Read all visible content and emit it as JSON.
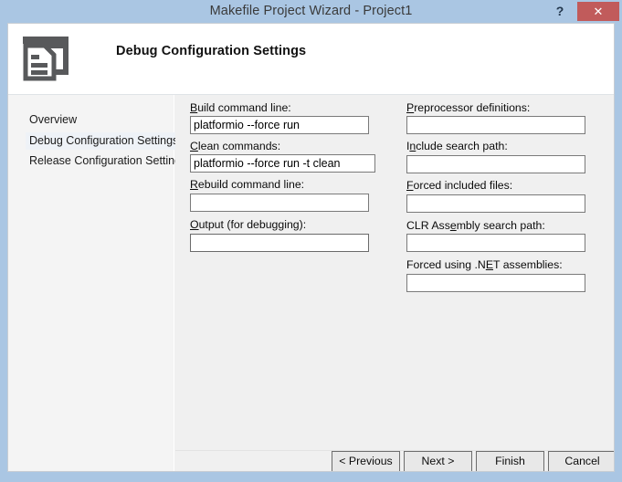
{
  "window": {
    "title": "Makefile Project Wizard - Project1",
    "help_label": "?",
    "close_label": "✕",
    "titlebar_color": "#aac6e3",
    "close_color": "#c15b5b"
  },
  "header": {
    "title": "Debug Configuration Settings",
    "icon": "window-document-icon"
  },
  "sidebar": {
    "items": [
      {
        "label": "Overview",
        "selected": false
      },
      {
        "label": "Debug Configuration Settings",
        "selected": true
      },
      {
        "label": "Release Configuration Settings",
        "selected": false
      }
    ]
  },
  "form": {
    "left_fields": [
      {
        "label": "Build command line:",
        "mnemonic": "B",
        "value": "platformio --force run",
        "placeholder": "",
        "focused": false
      },
      {
        "label": "Clean commands:",
        "mnemonic": "C",
        "value": "platformio --force run -t clean",
        "placeholder": "",
        "focused": false
      },
      {
        "label": "Rebuild command line:",
        "mnemonic": "R",
        "value": "",
        "placeholder": "",
        "focused": false
      },
      {
        "label": "Output (for debugging):",
        "mnemonic": "O",
        "value": "",
        "placeholder": "",
        "focused": true
      }
    ],
    "right_fields": [
      {
        "label": "Preprocessor definitions:",
        "mnemonic": "P",
        "value": "",
        "placeholder": "",
        "focused": false
      },
      {
        "label": "Include search path:",
        "mnemonic": "n",
        "value": "",
        "placeholder": "",
        "focused": false
      },
      {
        "label": "Forced included files:",
        "mnemonic": "F",
        "value": "",
        "placeholder": "",
        "focused": false
      },
      {
        "label": "CLR Assembly search path:",
        "mnemonic": "e",
        "value": "",
        "placeholder": "",
        "focused": false
      },
      {
        "label": "Forced using .NET assemblies:",
        "mnemonic": "E",
        "value": "",
        "placeholder": "",
        "focused": false
      }
    ]
  },
  "buttons": {
    "previous": "< Previous",
    "next": "Next >",
    "finish": "Finish",
    "cancel": "Cancel"
  }
}
